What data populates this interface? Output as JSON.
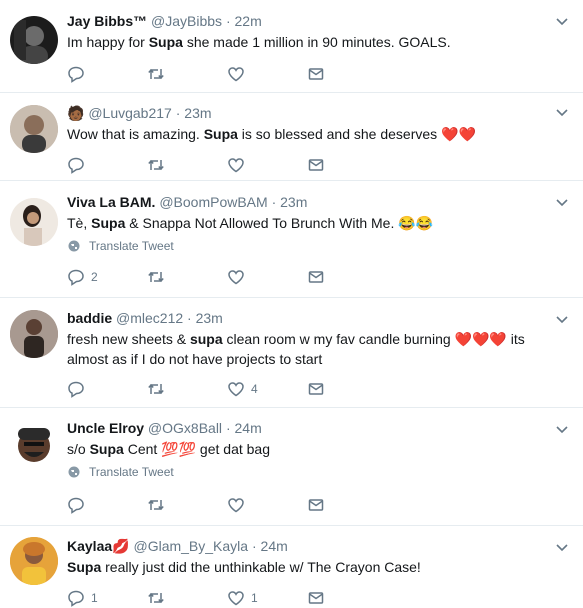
{
  "tweets": [
    {
      "name": "Jay Bibbs™",
      "handle": "@JayBibbs",
      "time": "22m",
      "text_before": "Im happy for ",
      "highlight": "Supa",
      "text_after": " she made 1 million in 90 minutes. GOALS.",
      "reply_count": "",
      "like_count": ""
    },
    {
      "name": "",
      "handle": "@Luvgab217",
      "time": "23m",
      "text_before": "Wow that is amazing. ",
      "highlight": "Supa",
      "text_after": " is so blessed and she deserves ",
      "emoji": "❤️❤️",
      "reply_count": "",
      "like_count": ""
    },
    {
      "name": "Viva La BAM.",
      "handle": "@BoomPowBAM",
      "time": "23m",
      "text_before": "Tè, ",
      "highlight": "Supa",
      "text_after": " & Snappa Not Allowed To Brunch With Me. ",
      "emoji": "😂😂",
      "translate": "Translate Tweet",
      "reply_count": "2",
      "like_count": ""
    },
    {
      "name": "baddie",
      "handle": "@mlec212",
      "time": "23m",
      "text_before": "fresh new sheets & ",
      "highlight": "supa",
      "text_after": " clean room w my fav candle burning ",
      "emoji": "❤️❤️❤️",
      "text_tail": " its almost as if I do not have projects to start",
      "reply_count": "",
      "like_count": "4"
    },
    {
      "name": "Uncle Elroy",
      "handle": "@OGx8Ball",
      "time": "24m",
      "text_before": "s/o ",
      "highlight": "Supa",
      "text_after": " Cent ",
      "emoji": "💯💯",
      "text_tail": " get dat bag",
      "translate": "Translate Tweet",
      "reply_count": "",
      "like_count": ""
    },
    {
      "name": "Kaylaa",
      "name_emoji": "💋",
      "handle": "@Glam_By_Kayla",
      "time": "24m",
      "text_before": "",
      "highlight": "Supa",
      "text_after": " really just did the unthinkable w/ The Crayon Case!",
      "reply_count": "1",
      "like_count": "1"
    }
  ],
  "separator": "·",
  "colors": {
    "icon": "#657786",
    "border": "#e6ecf0",
    "text": "#14171a"
  },
  "icons": [
    "reply-icon",
    "retweet-icon",
    "like-icon",
    "message-icon",
    "chevron-down-icon",
    "globe-icon"
  ]
}
